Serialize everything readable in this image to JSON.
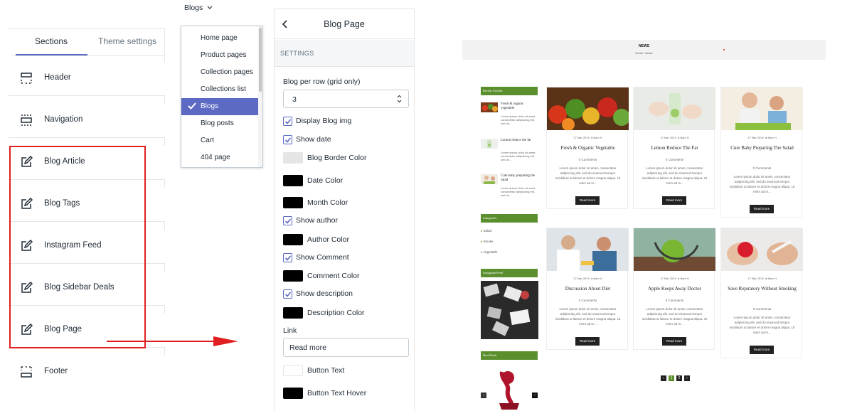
{
  "left_panel": {
    "tabs": [
      "Sections",
      "Theme settings"
    ],
    "items": [
      {
        "label": "Header",
        "icon": "header-section-icon"
      },
      {
        "label": "Navigation",
        "icon": "navigation-section-icon"
      },
      {
        "label": "Blog Article",
        "icon": "edit-icon"
      },
      {
        "label": "Blog Tags",
        "icon": "edit-icon"
      },
      {
        "label": "Instagram Feed",
        "icon": "edit-icon"
      },
      {
        "label": "Blog Sidebar Deals",
        "icon": "edit-icon"
      },
      {
        "label": "Blog Page",
        "icon": "edit-icon"
      },
      {
        "label": "Footer",
        "icon": "footer-section-icon"
      }
    ]
  },
  "page_select": {
    "current": "Blogs",
    "options": [
      "Home page",
      "Product pages",
      "Collection pages",
      "Collections list",
      "Blogs",
      "Blog posts",
      "Cart",
      "404 page"
    ],
    "selected_index": 4
  },
  "settings": {
    "title": "Blog Page",
    "section": "SETTINGS",
    "blog_per_row_label": "Blog per row (grid only)",
    "blog_per_row_value": "3",
    "display_blog_img": "Display Blog img",
    "show_date": "Show date",
    "blog_border_color": "Blog Border Color",
    "date_color": "Date Color",
    "month_color": "Month Color",
    "show_author": "Show author",
    "author_color": "Author Color",
    "show_comment": "Show Comment",
    "comment_color": "Comment Color",
    "show_description": "Show description",
    "description_color": "Description Color",
    "link_label": "Link",
    "link_value": "Read more",
    "button_text": "Button Text",
    "button_text_hover": "Button Text Hover",
    "colors": {
      "blog_border": "#e5e5e5",
      "date": "#000000",
      "month": "#000000",
      "author": "#000000",
      "comment": "#000000",
      "description": "#000000",
      "button_text": "#ffffff",
      "button_text_hover": "#000000",
      "accent": "#5c6ac4"
    }
  },
  "preview": {
    "banner_title": "NEWS",
    "breadcrumb": "Home  /  News",
    "sidebar": {
      "recent_title": "Recent Articles",
      "recent": [
        {
          "title": "Fresh & organic vegetable",
          "desc": "Lorem ipsum dolor sit amet, consectetur adipisicing elit, sed do..."
        },
        {
          "title": "Lemon reduce the fat",
          "desc": "Lorem ipsum dolor sit amet, consectetur adipisicing elit, sed do..."
        },
        {
          "title": "Cute baby preparing the salad",
          "desc": "Lorem ipsum dolor sit amet, consectetur adipisicing elit, sed do..."
        }
      ],
      "categories_title": "Categories",
      "categories": [
        "Salad",
        "Smoke",
        "Vegetable"
      ],
      "instagram_title": "Instagram Feed",
      "deals_title": "Best Deals"
    },
    "card_meta": {
      "date": "17 Mar 2019",
      "author": "Bam H"
    },
    "comments": "0 Comments",
    "excerpt": "Lorem ipsum dolor sit amet, consectetur adipisicing elit, sed do eiusmod tempor incididunt ut labore et dolore magna aliqua. Ut enim ad m...",
    "read_more": "Read more",
    "posts": [
      {
        "title": "Fresh & Organic Vegetable"
      },
      {
        "title": "Lemon Reduce The Fat"
      },
      {
        "title": "Cute Baby Preparing The Salad"
      },
      {
        "title": "Discussion About Diet"
      },
      {
        "title": "Apple Keeps Away Doctor"
      },
      {
        "title": "Save Repiratory Without Smoking"
      }
    ],
    "pagination": [
      "‹",
      "1",
      "2",
      "›"
    ]
  }
}
